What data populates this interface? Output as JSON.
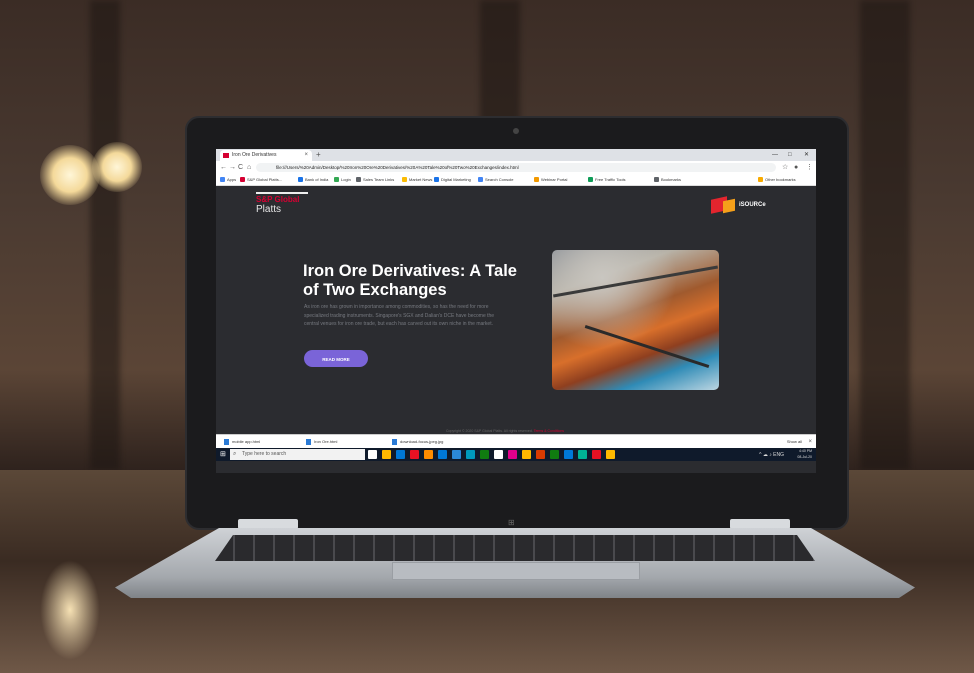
{
  "browser": {
    "tab_title": "Iron Ore Derivatives",
    "tab_close": "×",
    "new_tab": "+",
    "window_controls": [
      "—",
      "□",
      "✕"
    ],
    "nav": [
      "←",
      "→",
      "C",
      "⌂"
    ],
    "url": "file:///Users/%20Admin/Desktop/%20Iron%20Ore%20Derivatives/%20A%20Tale%20of%20Two%20Exchanges/index.html",
    "bookmarks": [
      {
        "label": "Apps",
        "color": "#4285f4"
      },
      {
        "label": "S&P Global Platts...",
        "color": "#d50032"
      },
      {
        "label": "Bank of India",
        "color": "#1a73e8"
      },
      {
        "label": "Login",
        "color": "#34a853"
      },
      {
        "label": "Sales Team Links",
        "color": "#5f6368"
      },
      {
        "label": "Market News",
        "color": "#fbbc04"
      },
      {
        "label": "Digital Marketing",
        "color": "#1a73e8"
      },
      {
        "label": "Search Console",
        "color": "#4285f4"
      },
      {
        "label": "Webinar Portal",
        "color": "#f29900"
      },
      {
        "label": "Free Traffic Tools",
        "color": "#0f9d58"
      },
      {
        "label": "Bookmarks",
        "color": "#5f6368"
      },
      {
        "label": "Other bookmarks",
        "color": "#f9ab00"
      }
    ]
  },
  "page": {
    "brand_top": "S&P Global",
    "brand_bottom": "Platts",
    "partner_logo": "iSOURCe",
    "headline": "Iron Ore Derivatives: A Tale of Two Exchanges",
    "body": "As iron ore has grown in importance among commodities, so has the need for more specialized trading instruments. Singapore's SGX and Dalian's DCE have become the central venues for iron ore trade, but each has carved out its own niche in the market.",
    "cta": "READ MORE",
    "copyright": "Copyright © 2020 S&P Global Platts. All rights reserved.",
    "copyright_link": "Terms & Conditions"
  },
  "downloads": {
    "items": [
      "mobile app.html",
      "Iron Ore.html",
      "download-focus-jpeg.jpg"
    ],
    "show_all": "Show all",
    "close": "×"
  },
  "taskbar": {
    "start": "⊞",
    "search_placeholder": "Type here to search",
    "search_icon": "⌕",
    "app_colors": [
      "#ffffff",
      "#ffb900",
      "#0078d7",
      "#e81123",
      "#ff8c00",
      "#0078d7",
      "#2b88d8",
      "#0099bc",
      "#107c10",
      "#ffffff",
      "#e3008c",
      "#ffb900",
      "#d83b01",
      "#107c10",
      "#0078d7",
      "#00b294",
      "#e81123",
      "#ffb900"
    ],
    "time": "4:40 PM",
    "date": "08-Jul-20",
    "tray_icons": "^ ☁ ♪ ENG"
  },
  "colors": {
    "accent": "#d50032",
    "cta": "#7a64d8",
    "page_bg": "#2b2c30"
  }
}
